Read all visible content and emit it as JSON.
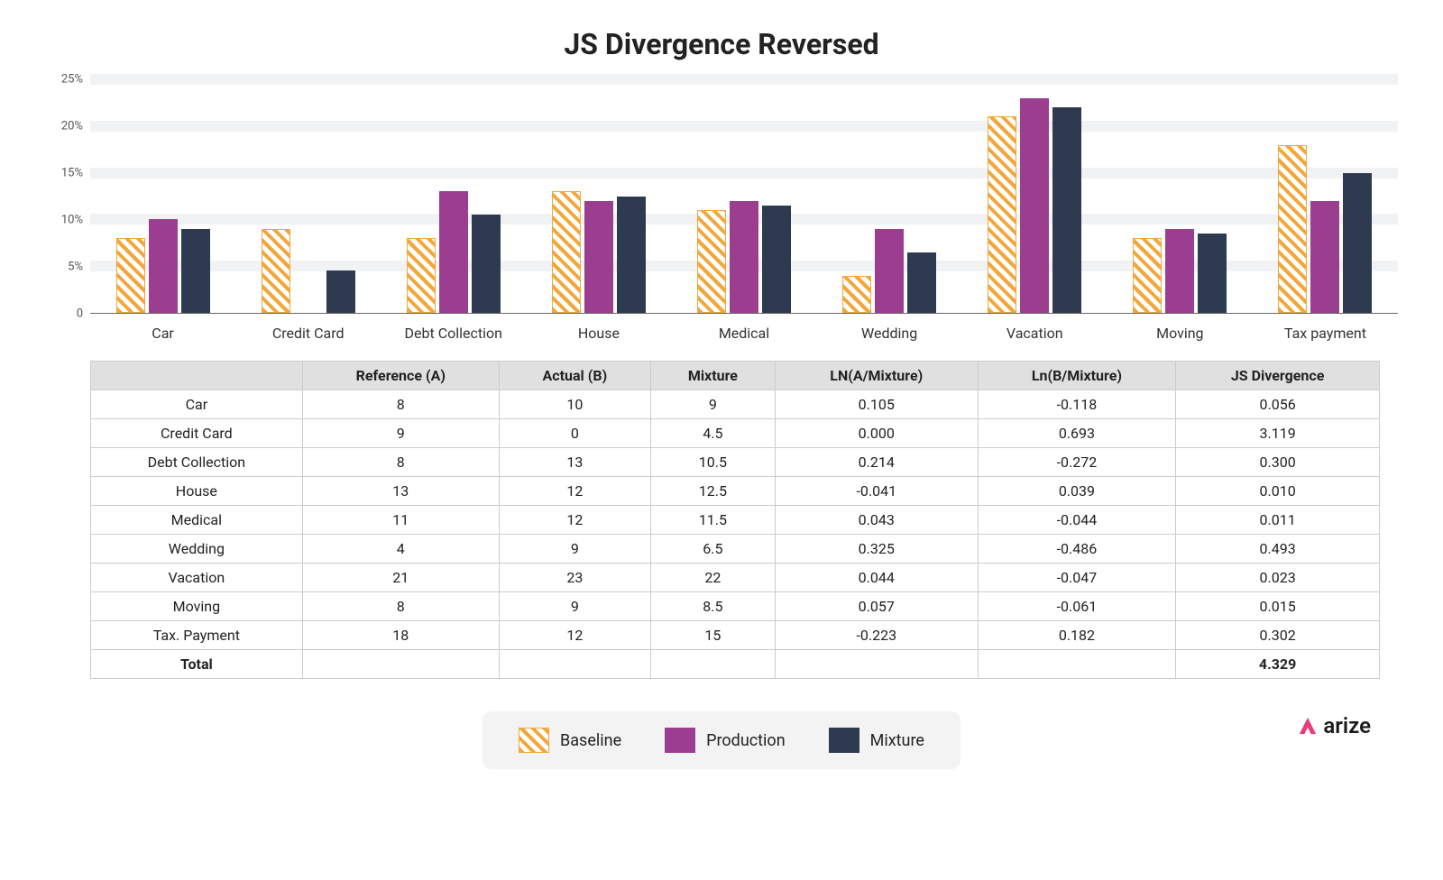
{
  "title": "JS Divergence Reversed",
  "chart_data": {
    "type": "bar",
    "ylim": [
      0,
      25
    ],
    "y_ticks": [
      0,
      5,
      10,
      15,
      20,
      25
    ],
    "y_tick_labels": [
      "0",
      "5%",
      "10%",
      "15%",
      "20%",
      "25%"
    ],
    "categories": [
      "Car",
      "Credit Card",
      "Debt Collection",
      "House",
      "Medical",
      "Wedding",
      "Vacation",
      "Moving",
      "Tax payment"
    ],
    "series": [
      {
        "name": "Baseline",
        "key": "baseline",
        "values": [
          8,
          9,
          8,
          13,
          11,
          4,
          21,
          8,
          18
        ]
      },
      {
        "name": "Production",
        "key": "production",
        "values": [
          10,
          0,
          13,
          12,
          12,
          9,
          23,
          9,
          12
        ]
      },
      {
        "name": "Mixture",
        "key": "mixture",
        "values": [
          9,
          4.5,
          10.5,
          12.5,
          11.5,
          6.5,
          22,
          8.5,
          15
        ]
      }
    ]
  },
  "table": {
    "headers": [
      "",
      "Reference (A)",
      "Actual (B)",
      "Mixture",
      "LN(A/Mixture)",
      "Ln(B/Mixture)",
      "JS Divergence"
    ],
    "rows": [
      [
        "Car",
        "8",
        "10",
        "9",
        "0.105",
        "-0.118",
        "0.056"
      ],
      [
        "Credit Card",
        "9",
        "0",
        "4.5",
        "0.000",
        "0.693",
        "3.119"
      ],
      [
        "Debt Collection",
        "8",
        "13",
        "10.5",
        "0.214",
        "-0.272",
        "0.300"
      ],
      [
        "House",
        "13",
        "12",
        "12.5",
        "-0.041",
        "0.039",
        "0.010"
      ],
      [
        "Medical",
        "11",
        "12",
        "11.5",
        "0.043",
        "-0.044",
        "0.011"
      ],
      [
        "Wedding",
        "4",
        "9",
        "6.5",
        "0.325",
        "-0.486",
        "0.493"
      ],
      [
        "Vacation",
        "21",
        "23",
        "22",
        "0.044",
        "-0.047",
        "0.023"
      ],
      [
        "Moving",
        "8",
        "9",
        "8.5",
        "0.057",
        "-0.061",
        "0.015"
      ],
      [
        "Tax. Payment",
        "18",
        "12",
        "15",
        "-0.223",
        "0.182",
        "0.302"
      ]
    ],
    "total_row": [
      "Total",
      "",
      "",
      "",
      "",
      "",
      "4.329"
    ]
  },
  "legend": {
    "items": [
      {
        "key": "baseline",
        "label": "Baseline"
      },
      {
        "key": "production",
        "label": "Production"
      },
      {
        "key": "mixture",
        "label": "Mixture"
      }
    ]
  },
  "logo": {
    "text": "arize"
  }
}
